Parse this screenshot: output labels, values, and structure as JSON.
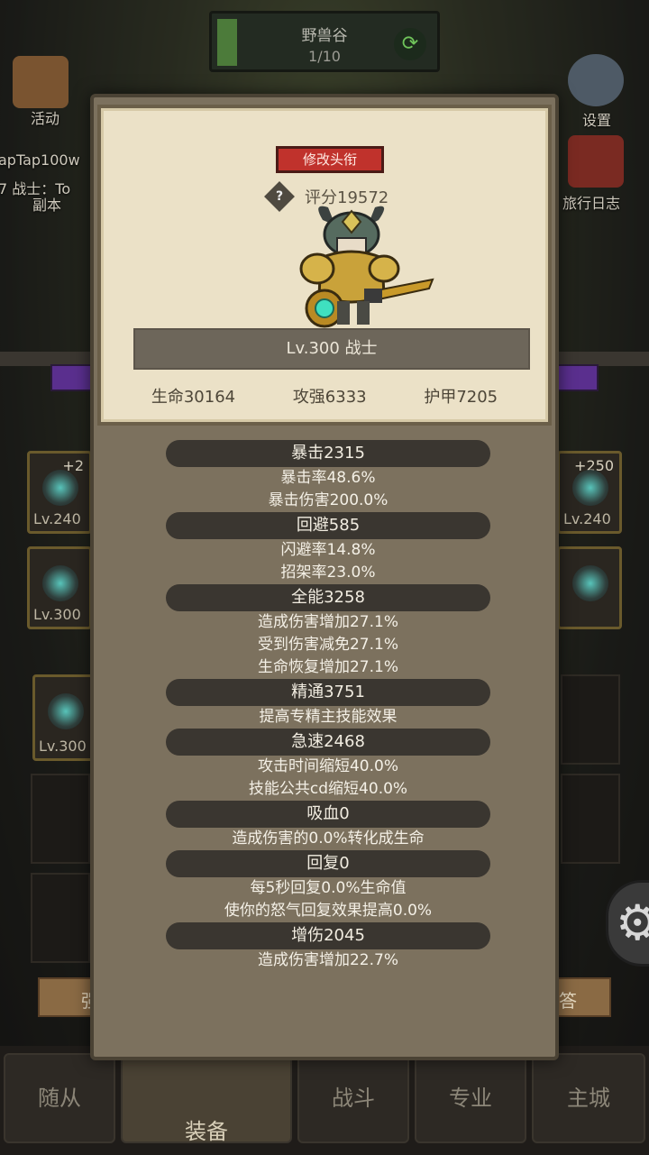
{
  "background": {
    "top_level": {
      "title": "野兽谷",
      "progress": "1/10"
    },
    "side_left": [
      {
        "label": "活动"
      },
      {
        "label": "apTap100w"
      },
      {
        "label": "7 战士：To"
      },
      {
        "label": "副本"
      }
    ],
    "side_right": [
      {
        "label": "设置"
      },
      {
        "label": "旅行日志"
      }
    ],
    "slots": [
      {
        "level": "Lv.240",
        "plus": "+2"
      },
      {
        "level": "Lv.300",
        "plus": ""
      },
      {
        "level": "Lv.240",
        "plus": "+250"
      },
      {
        "level": "Lv.300",
        "plus": ""
      }
    ],
    "bottom_nav": [
      "随从",
      "装备",
      "战斗",
      "专业",
      "主城"
    ],
    "strip_left": "强",
    "strip_right": "答"
  },
  "hero": {
    "edit_title_label": "修改头衔",
    "score": "评分19572",
    "name": "Lv.300 战士",
    "base_stats": [
      "生命30164",
      "攻强6333",
      "护甲7205"
    ]
  },
  "stats": [
    {
      "header": "暴击2315",
      "lines": [
        "暴击率48.6%",
        "暴击伤害200.0%"
      ]
    },
    {
      "header": "回避585",
      "lines": [
        "闪避率14.8%",
        "招架率23.0%"
      ]
    },
    {
      "header": "全能3258",
      "lines": [
        "造成伤害增加27.1%",
        "受到伤害减免27.1%",
        "生命恢复增加27.1%"
      ]
    },
    {
      "header": "精通3751",
      "lines": [
        "提高专精主技能效果"
      ]
    },
    {
      "header": "急速2468",
      "lines": [
        "攻击时间缩短40.0%",
        "技能公共cd缩短40.0%"
      ]
    },
    {
      "header": "吸血0",
      "lines": [
        "造成伤害的0.0%转化成生命"
      ]
    },
    {
      "header": "回复0",
      "lines": [
        "每5秒回复0.0%生命值",
        "使你的怒气回复效果提高0.0%"
      ]
    },
    {
      "header": "增伤2045",
      "lines": [
        "造成伤害增加22.7%"
      ]
    }
  ],
  "colors": {
    "modal_bg": "#7c715e",
    "card_bg": "#ebe1c7",
    "edit_btn": "#c0322c",
    "stat_header": "#3a3630"
  }
}
